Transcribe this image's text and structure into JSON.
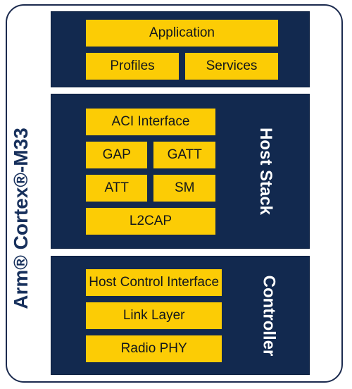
{
  "diagram": {
    "chip_label": "Arm® Cortex®-M33",
    "blocks": [
      {
        "id": "application",
        "side_label": "",
        "rows": [
          {
            "boxes": [
              {
                "label": "Application"
              }
            ]
          },
          {
            "boxes": [
              {
                "label": "Profiles"
              },
              {
                "label": "Services"
              }
            ]
          }
        ]
      },
      {
        "id": "host-stack",
        "side_label": "Host Stack",
        "rows": [
          {
            "boxes": [
              {
                "label": "ACI Interface"
              }
            ]
          },
          {
            "boxes": [
              {
                "label": "GAP"
              },
              {
                "label": "GATT"
              }
            ]
          },
          {
            "boxes": [
              {
                "label": "ATT"
              },
              {
                "label": "SM"
              }
            ]
          },
          {
            "boxes": [
              {
                "label": "L2CAP"
              }
            ]
          }
        ]
      },
      {
        "id": "controller",
        "side_label": "Controller",
        "rows": [
          {
            "boxes": [
              {
                "label": "Host Control Interface"
              }
            ]
          },
          {
            "boxes": [
              {
                "label": "Link Layer"
              }
            ]
          },
          {
            "boxes": [
              {
                "label": "Radio PHY"
              }
            ]
          }
        ]
      }
    ]
  },
  "colors": {
    "navy": "#12294f",
    "gold": "#fccc05",
    "outline": "#1b2a4e",
    "label_white": "#ffffff",
    "chip_label_navy": "#17305c"
  }
}
